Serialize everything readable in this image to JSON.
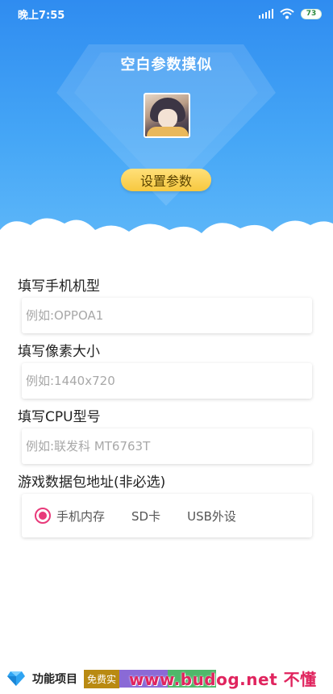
{
  "status_bar": {
    "time": "晚上7:55",
    "battery": "73"
  },
  "header": {
    "title": "空白参数摸似",
    "set_button": "设置参数"
  },
  "form": {
    "phone_model": {
      "label": "填写手机机型",
      "placeholder": "例如:OPPOA1"
    },
    "resolution": {
      "label": "填写像素大小",
      "placeholder": "例如:1440x720"
    },
    "cpu": {
      "label": "填写CPU型号",
      "placeholder": "例如:联发科 MT6763T"
    },
    "storage": {
      "label": "游戏数据包地址(非必选)",
      "options": [
        "手机内存",
        "SD卡",
        "USB外设"
      ],
      "selected": "手机内存"
    }
  },
  "footer": {
    "title": "功能项目",
    "tag": "免费实",
    "watermark": "www.budog.net 不懂社区"
  },
  "colors": {
    "header_top": "#2f8cf0",
    "header_bottom": "#5fb8f9",
    "button": "#f7c83f",
    "radio_accent": "#e83a7a"
  },
  "icons": [
    "signal-icon",
    "wifi-icon",
    "battery-icon",
    "diamond-icon"
  ]
}
